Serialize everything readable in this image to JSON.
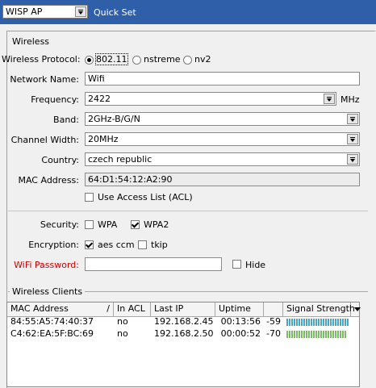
{
  "top": {
    "mode_value": "WISP AP",
    "title": "Quick Set"
  },
  "wireless": {
    "section": "Wireless",
    "protocol": {
      "label": "Wireless Protocol:",
      "options": [
        "802.11",
        "nstreme",
        "nv2"
      ],
      "selected": "802.11"
    },
    "network_name": {
      "label": "Network Name:",
      "value": "Wifi"
    },
    "frequency": {
      "label": "Frequency:",
      "value": "2422",
      "unit": "MHz"
    },
    "band": {
      "label": "Band:",
      "value": "2GHz-B/G/N"
    },
    "channel_width": {
      "label": "Channel Width:",
      "value": "20MHz"
    },
    "country": {
      "label": "Country:",
      "value": "czech republic"
    },
    "mac_address": {
      "label": "MAC Address:",
      "value": "64:D1:54:12:A2:90"
    },
    "access_list": {
      "label": "Use Access List (ACL)",
      "checked": false
    },
    "security": {
      "label": "Security:",
      "wpa": "WPA",
      "wpa_checked": false,
      "wpa2": "WPA2",
      "wpa2_checked": true
    },
    "encryption": {
      "label": "Encryption:",
      "aes": "aes ccm",
      "aes_checked": true,
      "tkip": "tkip",
      "tkip_checked": false
    },
    "password": {
      "label": "WiFi Password:",
      "value": "",
      "hide_label": "Hide",
      "hide_checked": false
    }
  },
  "clients": {
    "section": "Wireless Clients",
    "columns": [
      "MAC Address",
      "In ACL",
      "Last IP",
      "Uptime",
      "Signal Strength"
    ],
    "rows": [
      {
        "mac": "84:55:A5:74:40:37",
        "in_acl": "no",
        "last_ip": "192.168.2.45",
        "uptime": "00:13:56",
        "signal": "-59",
        "signal_level": 1.0
      },
      {
        "mac": "C4:62:EA:5F:BC:69",
        "in_acl": "no",
        "last_ip": "192.168.2.50",
        "uptime": "00:00:52",
        "signal": "-70",
        "signal_level": 0.95
      }
    ]
  },
  "colors": {
    "titlebar": "#2f5fa9",
    "signal_good": "#4aa6c8",
    "signal_mid": "#7fb86b",
    "error_label": "#d00000"
  }
}
